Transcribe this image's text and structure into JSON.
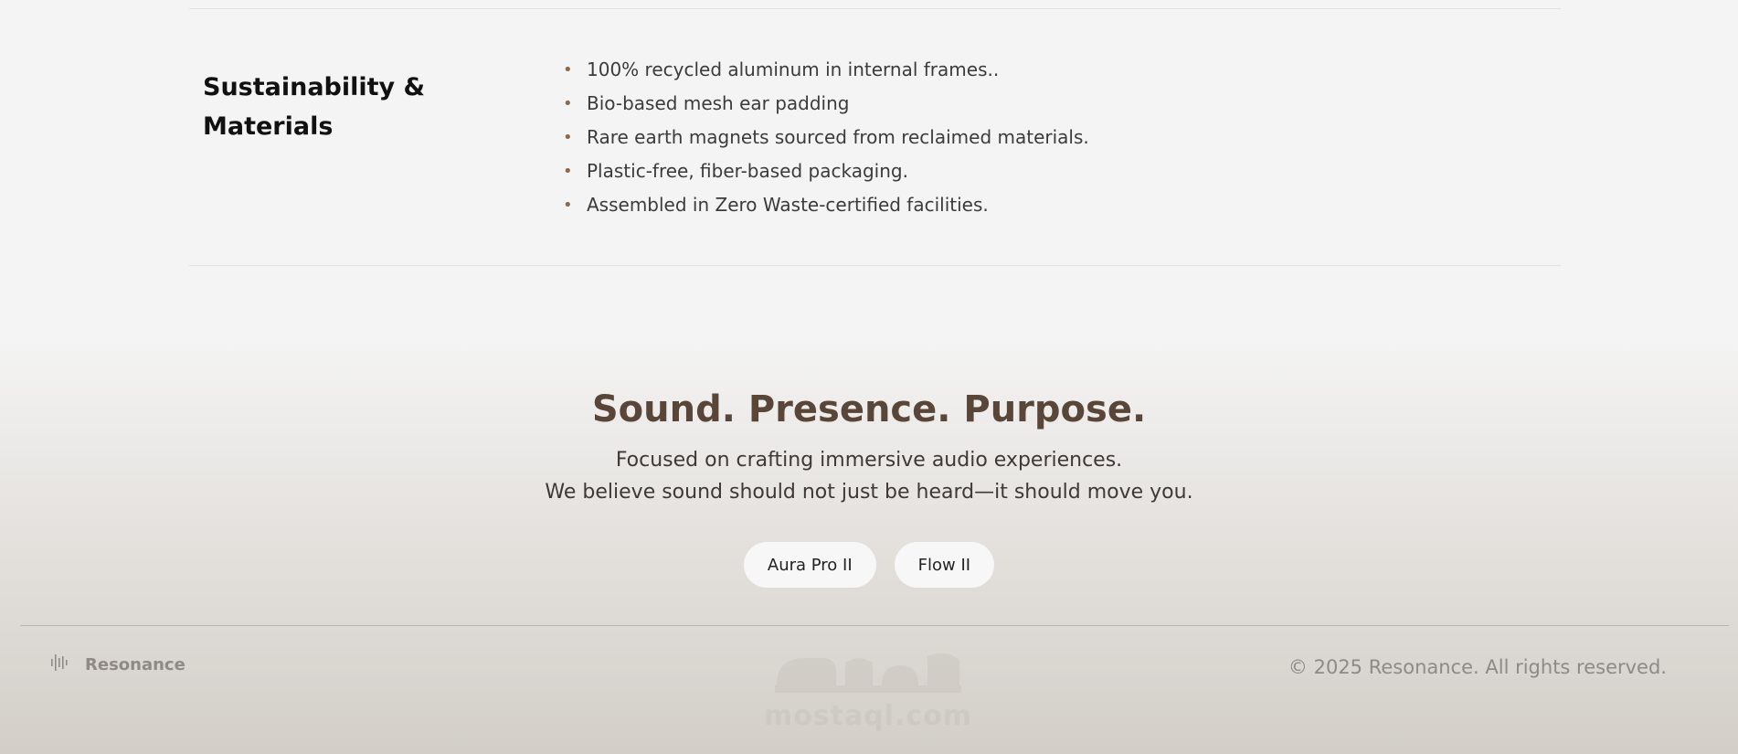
{
  "specs": {
    "title": "Sustainability & Materials",
    "items": [
      "100% recycled aluminum in internal frames..",
      "Bio-based mesh ear padding",
      "Rare earth magnets sourced from reclaimed materials.",
      "Plastic-free, fiber-based packaging.",
      "Assembled in Zero Waste-certified facilities."
    ]
  },
  "hero": {
    "title": "Sound. Presence. Purpose.",
    "line1": "Focused on crafting immersive audio experiences.",
    "line2": "We believe sound should not just be heard—it should move you."
  },
  "buttons": {
    "aura": "Aura Pro II",
    "flow": "Flow II"
  },
  "footer": {
    "brand": "Resonance",
    "brand_icon": "soundwave-icon",
    "copyright": "© 2025 Resonance. All rights reserved.",
    "watermark": "mostaql.com"
  },
  "colors": {
    "accent_brown": "#5a4638",
    "bullet": "#8a6a4a",
    "muted": "#8f8a85"
  }
}
